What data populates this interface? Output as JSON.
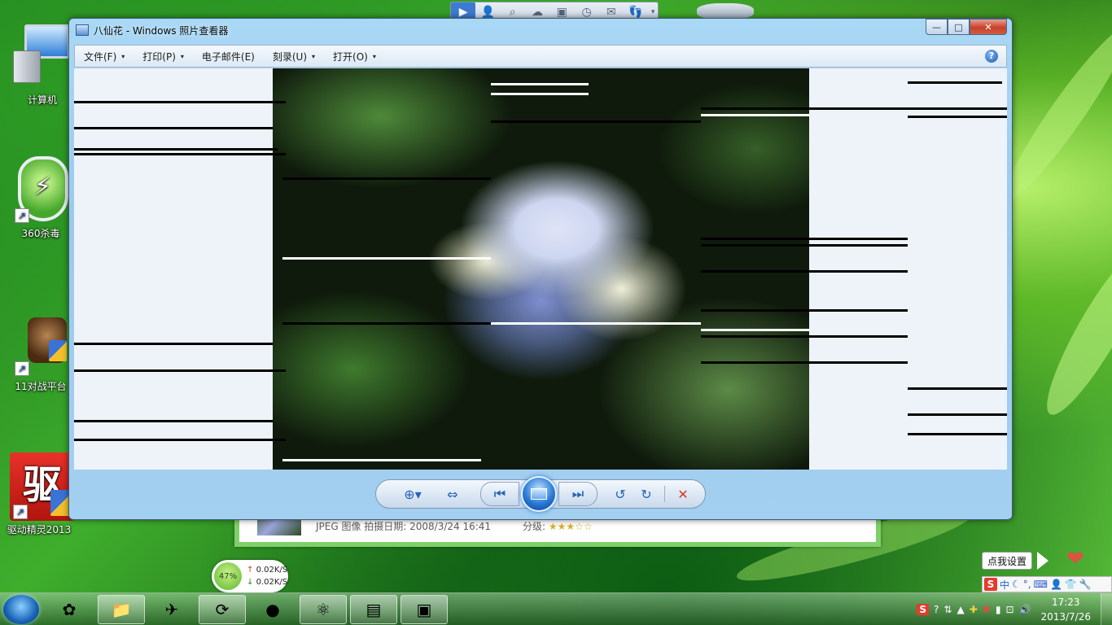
{
  "desktop": {
    "icons": [
      {
        "label": "计算机",
        "icon": "computer-icon"
      },
      {
        "label": "360杀毒",
        "icon": "antivirus-shield-icon"
      },
      {
        "label": "11对战平台",
        "icon": "game-platform-icon"
      },
      {
        "label": "驱动精灵2013",
        "icon": "driver-genius-icon"
      }
    ]
  },
  "quickbar": {
    "buttons": [
      "play-icon",
      "user-icon",
      "search-icon",
      "cloud-icon",
      "photo-icon",
      "clock-icon",
      "mail-icon",
      "footprint-icon",
      "dropdown-icon"
    ]
  },
  "photo_viewer": {
    "title": "八仙花 - Windows 照片查看器",
    "menu": [
      {
        "label": "文件(F)",
        "caret": "▾"
      },
      {
        "label": "打印(P)",
        "caret": "▾"
      },
      {
        "label": "电子邮件(E)",
        "caret": ""
      },
      {
        "label": "刻录(U)",
        "caret": "▾"
      },
      {
        "label": "打开(O)",
        "caret": "▾"
      }
    ],
    "help_label": "?",
    "window_controls": {
      "minimize": "—",
      "maximize": "□",
      "close": "✕"
    },
    "toolbar": {
      "zoom": "zoom-icon",
      "fit": "actual-size-icon",
      "previous": "previous-icon",
      "slideshow": "slideshow-icon",
      "next": "next-icon",
      "rotate_left": "rotate-ccw-icon",
      "rotate_right": "rotate-cw-icon",
      "delete": "delete-icon"
    }
  },
  "behind_window": {
    "info": "JPEG 图像  拍摄日期: 2008/3/24 16:41",
    "rating_label": "分级:",
    "rating": 3,
    "stars": "★★★☆☆"
  },
  "net_widget": {
    "percent": "47%",
    "upload": "0.02K/S",
    "download": "0.02K/S"
  },
  "tray_tool": {
    "settings_label": "点我设置",
    "ime_lang": "中"
  },
  "taskbar": {
    "apps": [
      "color-flower-icon",
      "file-explorer-icon",
      "bird-icon",
      "refresh-icon",
      "fruit-icon",
      "dev-tool-icon",
      "notes-icon",
      "photo-viewer-icon"
    ],
    "clock_time": "17:23",
    "clock_date": "2013/7/26"
  },
  "colors": {
    "window_frame": "#a9d8f5",
    "accent_blue": "#2563b8",
    "delete_red": "#d33b2c"
  }
}
